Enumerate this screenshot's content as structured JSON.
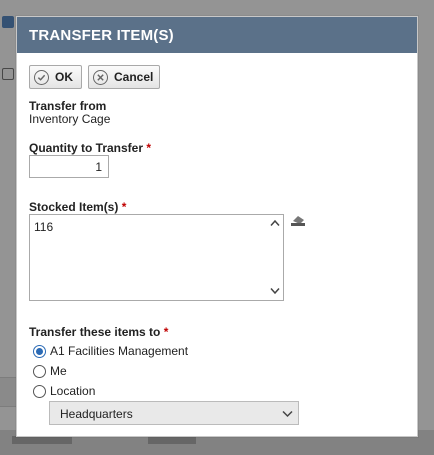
{
  "dialog": {
    "title": "TRANSFER ITEM(S)",
    "ok_label": "OK",
    "cancel_label": "Cancel",
    "transfer_from_label": "Transfer from",
    "transfer_from_value": "Inventory Cage",
    "quantity_label": "Quantity to Transfer",
    "quantity_value": "1",
    "stocked_items_label": "Stocked Item(s)",
    "stocked_items_value": "116",
    "required_mark": "*",
    "transfer_to_label": "Transfer these items to",
    "options": [
      {
        "label": "A1 Facilities Management",
        "selected": true
      },
      {
        "label": "Me",
        "selected": false
      },
      {
        "label": "Location",
        "selected": false
      }
    ],
    "location_select_value": "Headquarters",
    "header_color": "#5b7189",
    "radio_color": "#2a6ab5"
  },
  "icons": {
    "ok": "check-circle-icon",
    "cancel": "x-circle-icon",
    "clear": "eraser-icon",
    "scroll_up": "chevron-up-icon",
    "scroll_down": "chevron-down-icon",
    "select": "chevron-down-icon"
  }
}
